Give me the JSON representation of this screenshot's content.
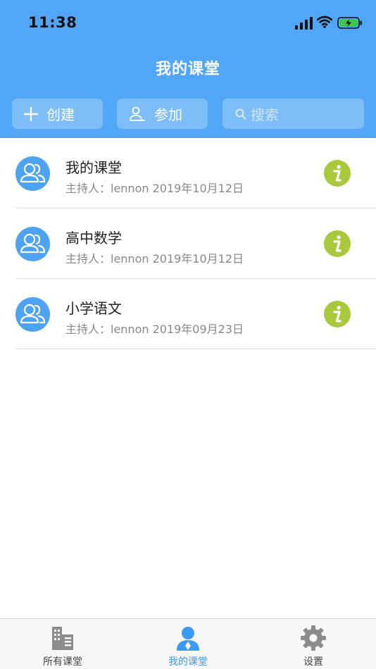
{
  "status_bar": {
    "time": "11:38"
  },
  "header": {
    "title": "我的课堂"
  },
  "actions": {
    "create_label": "创建",
    "join_label": "参加",
    "search_placeholder": "搜索"
  },
  "classes": [
    {
      "name": "我的课堂",
      "host": "主持人：lennon  2019年10月12日"
    },
    {
      "name": "高中数学",
      "host": "主持人：lennon  2019年10月12日"
    },
    {
      "name": "小学语文",
      "host": "主持人：lennon  2019年09月23日"
    }
  ],
  "tabbar": {
    "items": [
      {
        "label": "所有课堂",
        "icon": "building-icon",
        "active": false
      },
      {
        "label": "我的课堂",
        "icon": "user-icon",
        "active": true
      },
      {
        "label": "设置",
        "icon": "gear-icon",
        "active": false
      }
    ]
  },
  "colors": {
    "header": "#52a6f7",
    "button": "#7dbdf8",
    "avatar": "#4da3f1",
    "info": "#a9c83b",
    "active_tab": "#3c9af2"
  }
}
